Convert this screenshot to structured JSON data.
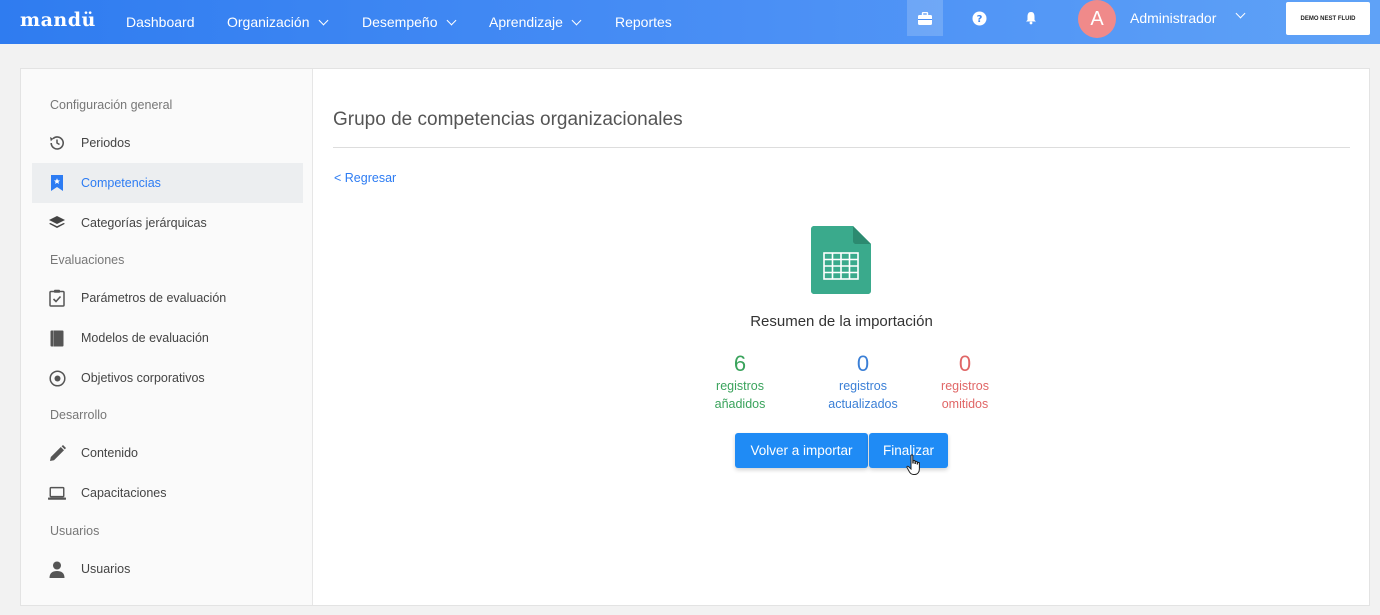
{
  "topbar": {
    "logo": "mandü",
    "nav": [
      {
        "label": "Dashboard"
      },
      {
        "label": "Organización"
      },
      {
        "label": "Desempeño"
      },
      {
        "label": "Aprendizaje"
      },
      {
        "label": "Reportes"
      }
    ],
    "icons": [
      "briefcase-icon",
      "help-icon",
      "bell-icon"
    ],
    "avatar_letter": "A",
    "user_name": "Administrador",
    "company": "DEMO NEST FLUID"
  },
  "sidebar": {
    "sections": [
      {
        "title": "Configuración general",
        "items": [
          {
            "label": "Periodos",
            "icon": "history-icon"
          },
          {
            "label": "Competencias",
            "icon": "bookmark-icon",
            "active": true
          },
          {
            "label": "Categorías jerárquicas",
            "icon": "layers-icon"
          }
        ]
      },
      {
        "title": "Evaluaciones",
        "items": [
          {
            "label": "Parámetros de evaluación",
            "icon": "clipboard-check-icon"
          },
          {
            "label": "Modelos de evaluación",
            "icon": "book-icon"
          },
          {
            "label": "Objetivos corporativos",
            "icon": "target-icon"
          }
        ]
      },
      {
        "title": "Desarrollo",
        "items": [
          {
            "label": "Contenido",
            "icon": "pencil-icon"
          },
          {
            "label": "Capacitaciones",
            "icon": "laptop-icon"
          }
        ]
      },
      {
        "title": "Usuarios",
        "items": [
          {
            "label": "Usuarios",
            "icon": "user-icon"
          }
        ]
      }
    ]
  },
  "main": {
    "title": "Grupo de competencias organizacionales",
    "back_link": "< Regresar",
    "summary_title": "Resumen de la importación",
    "stats": [
      {
        "value": "6",
        "line1": "registros",
        "line2": "añadidos",
        "color": "#3aa35c"
      },
      {
        "value": "0",
        "line1": "registros",
        "line2": "actualizados",
        "color": "#3a7fd6"
      },
      {
        "value": "0",
        "line1": "registros",
        "line2": "omitidos",
        "color": "#e06666"
      }
    ],
    "buttons": {
      "reimport": "Volver a importar",
      "finish": "Finalizar"
    }
  },
  "colors": {
    "accent": "#1f8bf5",
    "topbar": "#2f7cf0",
    "file_icon": "#3aaa8c"
  }
}
